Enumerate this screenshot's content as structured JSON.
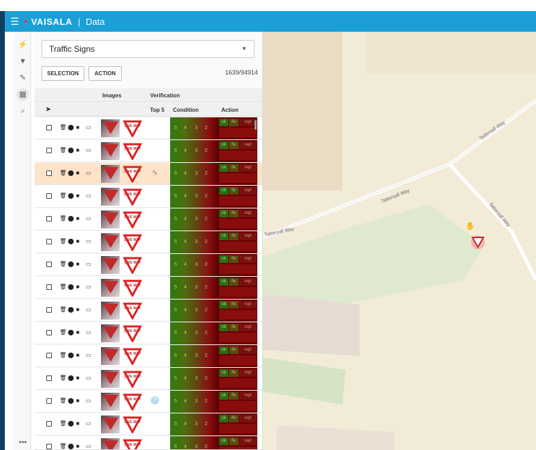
{
  "topbar": {
    "brand": "VAISALA",
    "separator": "|",
    "title": "Data"
  },
  "rail": {
    "icons": [
      "bolt-icon",
      "filter-icon",
      "wrench-icon",
      "table-icon",
      "search-icon",
      "more-icon"
    ]
  },
  "panel": {
    "layer_select": "Traffic Signs",
    "selection_button": "SELECTION",
    "action_button": "ACTION",
    "counter": "1639/94914",
    "groups": {
      "images": "Images",
      "verification": "Verification"
    },
    "columns": {
      "top5": "Top 5",
      "condition": "Condition",
      "action": "Action"
    },
    "condition_values": [
      "5",
      "4",
      "3",
      "2"
    ],
    "action_labels": {
      "ok": "ok",
      "fix": "fix",
      "replace": "repl"
    },
    "sign_text": "GIVE WAY",
    "rows": [
      {
        "selected": false,
        "marker": ""
      },
      {
        "selected": false,
        "marker": ""
      },
      {
        "selected": true,
        "marker": "pencil"
      },
      {
        "selected": false,
        "marker": ""
      },
      {
        "selected": false,
        "marker": ""
      },
      {
        "selected": false,
        "marker": ""
      },
      {
        "selected": false,
        "marker": ""
      },
      {
        "selected": false,
        "marker": ""
      },
      {
        "selected": false,
        "marker": ""
      },
      {
        "selected": false,
        "marker": ""
      },
      {
        "selected": false,
        "marker": ""
      },
      {
        "selected": false,
        "marker": ""
      },
      {
        "selected": false,
        "marker": "question"
      },
      {
        "selected": false,
        "marker": ""
      },
      {
        "selected": false,
        "marker": ""
      }
    ]
  },
  "map": {
    "roads": [
      "Tattersall Way",
      "Tattersall Way",
      "Tattersall Way",
      "Tattersall Way"
    ]
  },
  "colors": {
    "topbar": "#1aa0d6",
    "frame": "#0f3f60",
    "selected_row": "#fde3c8"
  }
}
